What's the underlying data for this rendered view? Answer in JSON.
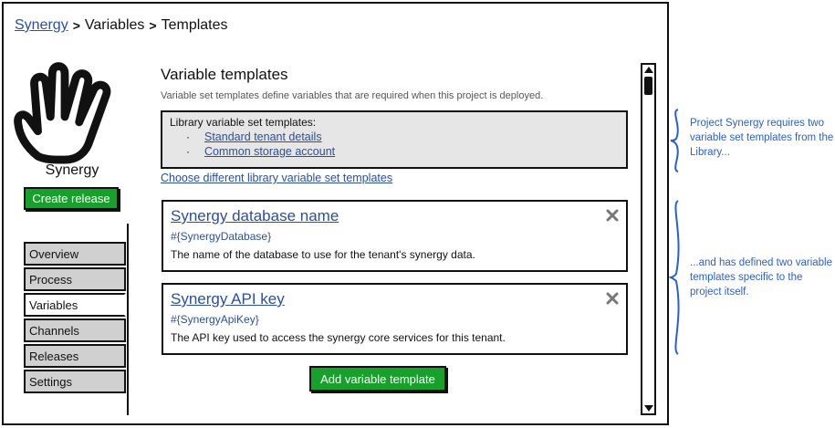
{
  "breadcrumb": {
    "project": "Synergy",
    "sep": ">",
    "variables": "Variables",
    "templates": "Templates"
  },
  "sidebar": {
    "project_name": "Synergy",
    "create_release": "Create release",
    "nav": [
      {
        "label": "Overview"
      },
      {
        "label": "Process"
      },
      {
        "label": "Variables"
      },
      {
        "label": "Channels"
      },
      {
        "label": "Releases"
      },
      {
        "label": "Settings"
      }
    ]
  },
  "main": {
    "title": "Variable templates",
    "description": "Variable set templates define variables that are required when this project is deployed.",
    "library": {
      "heading": "Library variable set templates:",
      "bullet": "·",
      "items": [
        "Standard tenant details",
        "Common storage account"
      ]
    },
    "choose_link": "Choose different library variable set templates",
    "templates": [
      {
        "title": "Synergy database name",
        "variable": "#{SynergyDatabase}",
        "description": "The name of the database to use for the tenant's synergy data."
      },
      {
        "title": "Synergy API key",
        "variable": "#{SynergyApiKey}",
        "description": "The API key used to access the synergy core services for this tenant."
      }
    ],
    "add_button": "Add variable template"
  },
  "annotations": {
    "library_note": "Project Synergy requires two variable set templates from the Library...",
    "templates_note": "...and has defined two variable templates specific to the project itself."
  },
  "colors": {
    "accent": "#2a4fa0",
    "button_green": "#17a12b",
    "annotation": "#2a5fd0"
  }
}
